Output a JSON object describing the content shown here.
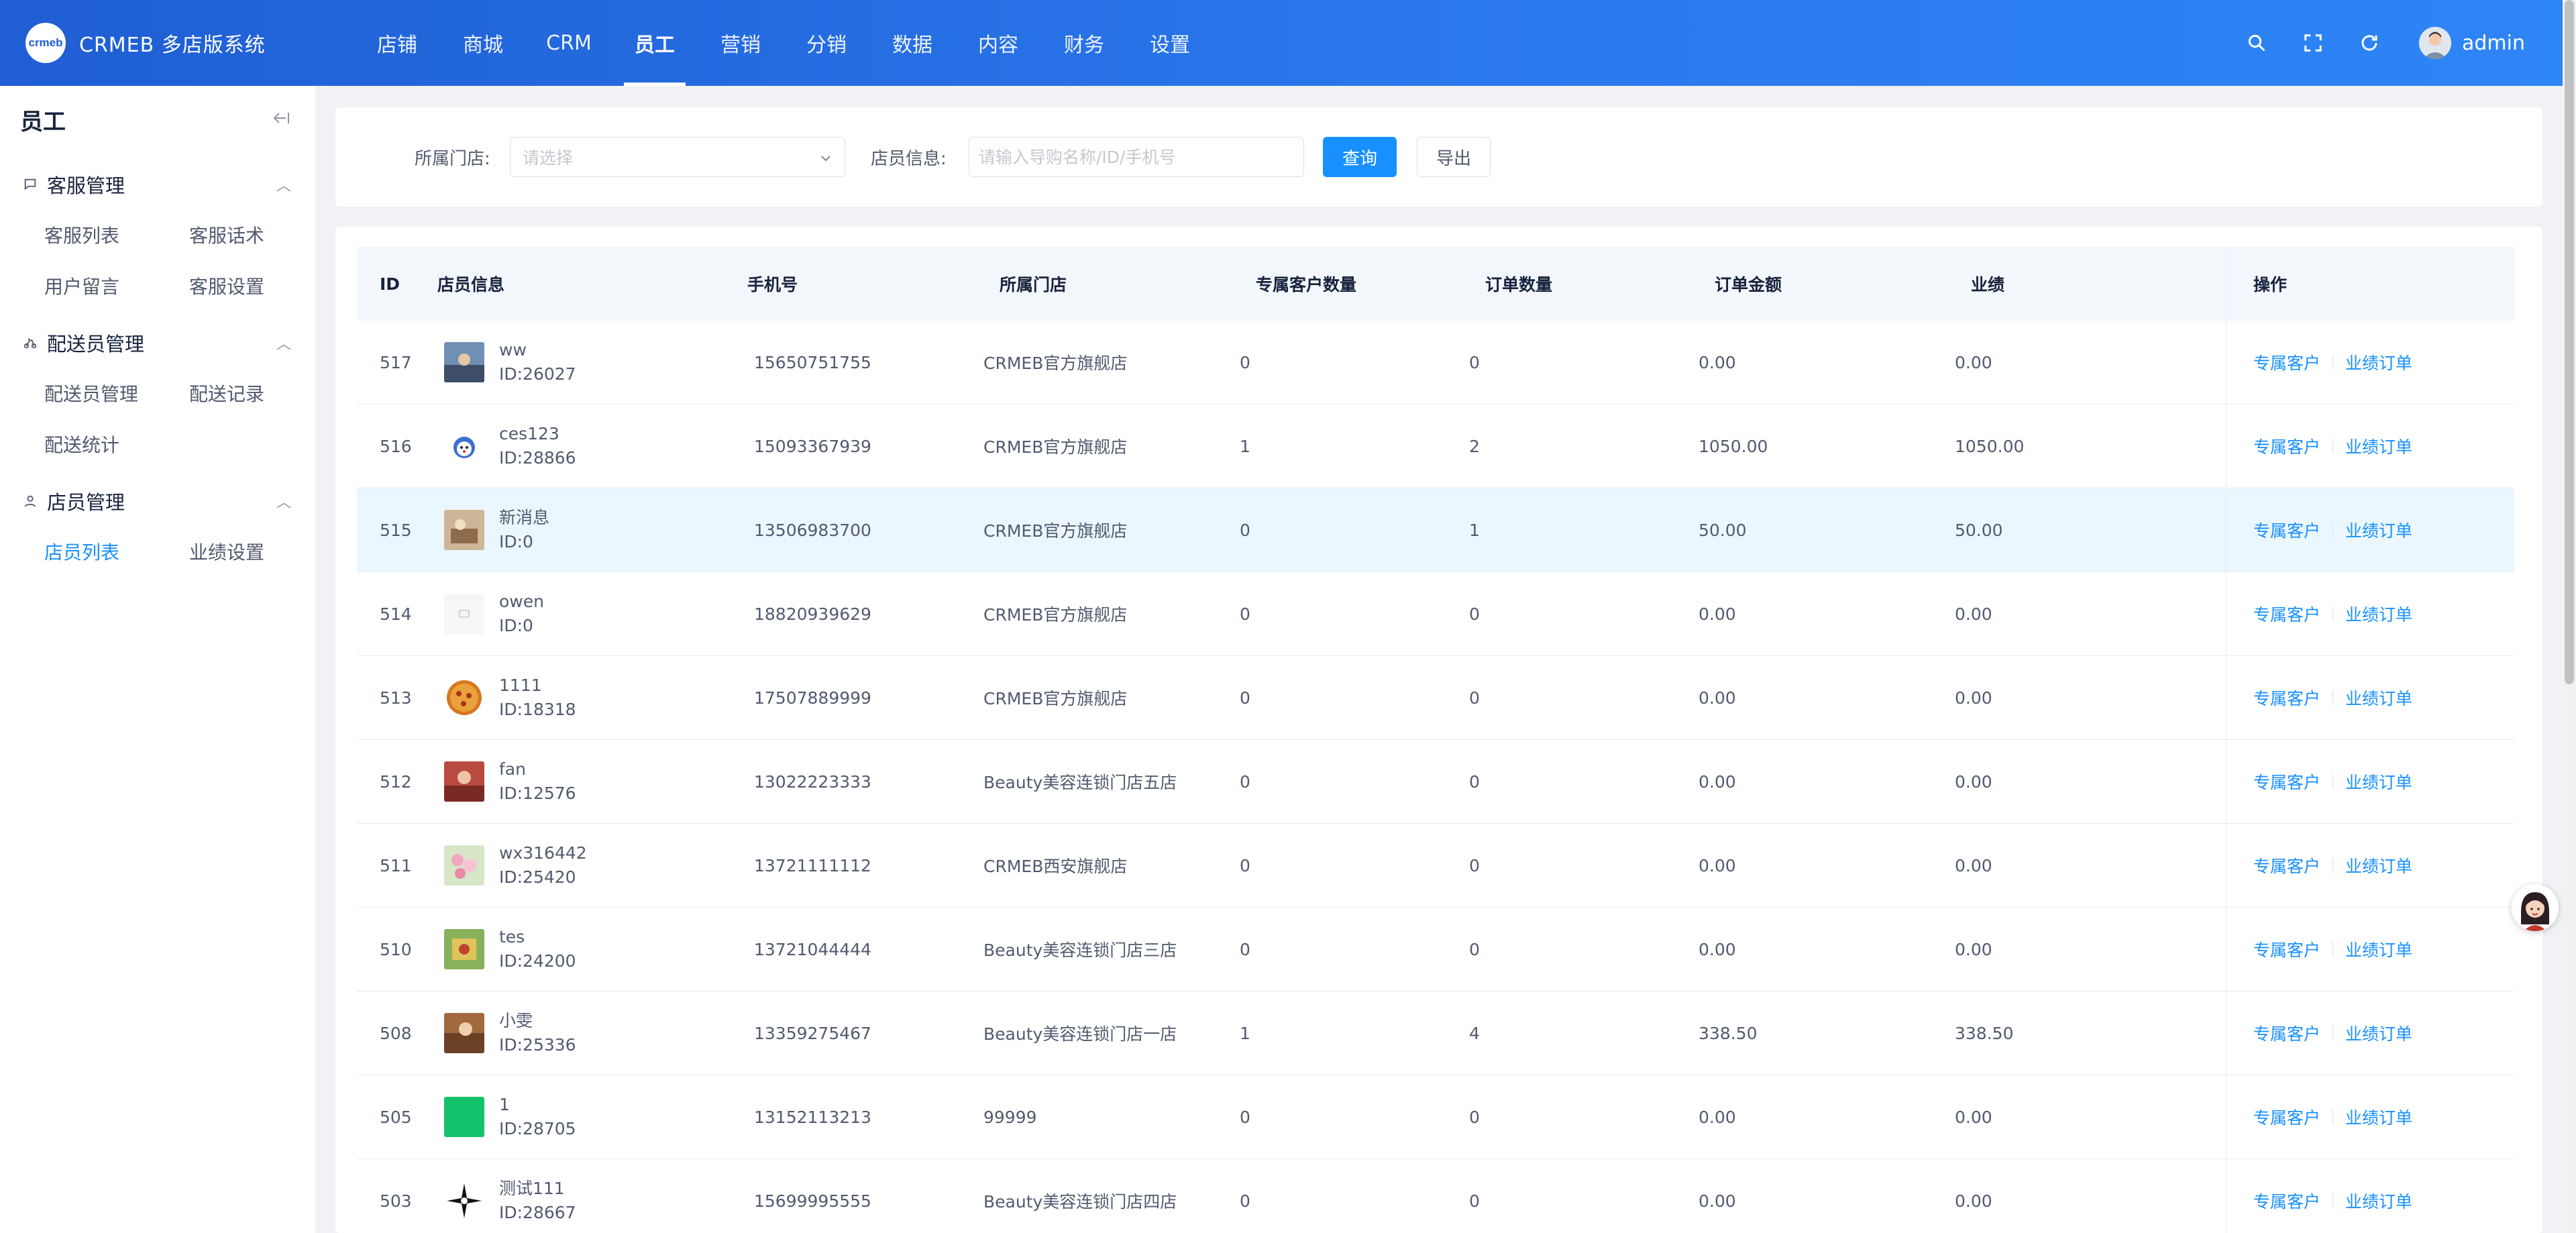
{
  "header": {
    "logo_text": "crmeb",
    "title": "CRMEB 多店版系统",
    "nav": [
      "店铺",
      "商城",
      "CRM",
      "员工",
      "营销",
      "分销",
      "数据",
      "内容",
      "财务",
      "设置"
    ],
    "active_nav": "员工",
    "user_name": "admin"
  },
  "sidebar": {
    "title": "员工",
    "groups": [
      {
        "label": "客服管理",
        "icon": "chat-icon",
        "items": [
          "客服列表",
          "客服话术",
          "用户留言",
          "客服设置"
        ]
      },
      {
        "label": "配送员管理",
        "icon": "delivery-icon",
        "items": [
          "配送员管理",
          "配送记录",
          "配送统计"
        ]
      },
      {
        "label": "店员管理",
        "icon": "user-icon",
        "items": [
          "店员列表",
          "业绩设置"
        ]
      }
    ],
    "active_item": "店员列表"
  },
  "filter": {
    "store_label": "所属门店:",
    "store_placeholder": "请选择",
    "info_label": "店员信息:",
    "info_placeholder": "请输入导购名称/ID/手机号",
    "query_button": "查询",
    "export_button": "导出"
  },
  "table": {
    "columns": [
      "ID",
      "店员信息",
      "手机号",
      "所属门店",
      "专属客户数量",
      "订单数量",
      "订单金额",
      "业绩",
      "操作"
    ],
    "op_links": [
      "专属客户",
      "业绩订单"
    ],
    "rows": [
      {
        "id": "517",
        "name": "ww",
        "uid": "ID:26027",
        "phone": "15650751755",
        "store": "CRMEB官方旗舰店",
        "customers": "0",
        "orders": "0",
        "amount": "0.00",
        "performance": "0.00",
        "avatar": "photo-blue"
      },
      {
        "id": "516",
        "name": "ces123",
        "uid": "ID:28866",
        "phone": "15093367939",
        "store": "CRMEB官方旗舰店",
        "customers": "1",
        "orders": "2",
        "amount": "1050.00",
        "performance": "1050.00",
        "avatar": "cartoon"
      },
      {
        "id": "515",
        "name": "新消息",
        "uid": "ID:0",
        "phone": "13506983700",
        "store": "CRMEB官方旗舰店",
        "customers": "0",
        "orders": "1",
        "amount": "50.00",
        "performance": "50.00",
        "avatar": "photo-beige"
      },
      {
        "id": "514",
        "name": "owen",
        "uid": "ID:0",
        "phone": "18820939629",
        "store": "CRMEB官方旗舰店",
        "customers": "0",
        "orders": "0",
        "amount": "0.00",
        "performance": "0.00",
        "avatar": "placeholder"
      },
      {
        "id": "513",
        "name": "1111",
        "uid": "ID:18318",
        "phone": "17507889999",
        "store": "CRMEB官方旗舰店",
        "customers": "0",
        "orders": "0",
        "amount": "0.00",
        "performance": "0.00",
        "avatar": "pizza"
      },
      {
        "id": "512",
        "name": "fan",
        "uid": "ID:12576",
        "phone": "13022223333",
        "store": "Beauty美容连锁门店五店",
        "customers": "0",
        "orders": "0",
        "amount": "0.00",
        "performance": "0.00",
        "avatar": "photo-red"
      },
      {
        "id": "511",
        "name": "wx316442",
        "uid": "ID:25420",
        "phone": "13721111112",
        "store": "CRMEB西安旗舰店",
        "customers": "0",
        "orders": "0",
        "amount": "0.00",
        "performance": "0.00",
        "avatar": "photo-flowers"
      },
      {
        "id": "510",
        "name": "tes",
        "uid": "ID:24200",
        "phone": "13721044444",
        "store": "Beauty美容连锁门店三店",
        "customers": "0",
        "orders": "0",
        "amount": "0.00",
        "performance": "0.00",
        "avatar": "photo-green"
      },
      {
        "id": "508",
        "name": "小雯",
        "uid": "ID:25336",
        "phone": "13359275467",
        "store": "Beauty美容连锁门店一店",
        "customers": "1",
        "orders": "4",
        "amount": "338.50",
        "performance": "338.50",
        "avatar": "photo-brown"
      },
      {
        "id": "505",
        "name": "1",
        "uid": "ID:28705",
        "phone": "13152113213",
        "store": "99999",
        "customers": "0",
        "orders": "0",
        "amount": "0.00",
        "performance": "0.00",
        "avatar": "solid-green"
      },
      {
        "id": "503",
        "name": "测试111",
        "uid": "ID:28667",
        "phone": "15699995555",
        "store": "Beauty美容连锁门店四店",
        "customers": "0",
        "orders": "0",
        "amount": "0.00",
        "performance": "0.00",
        "avatar": "star-black"
      }
    ]
  },
  "colors": {
    "header_gradient_start": "#1f5ed3",
    "header_gradient_end": "#2e85f5",
    "primary": "#1890ff",
    "hover_row": "#ebf7ff"
  }
}
